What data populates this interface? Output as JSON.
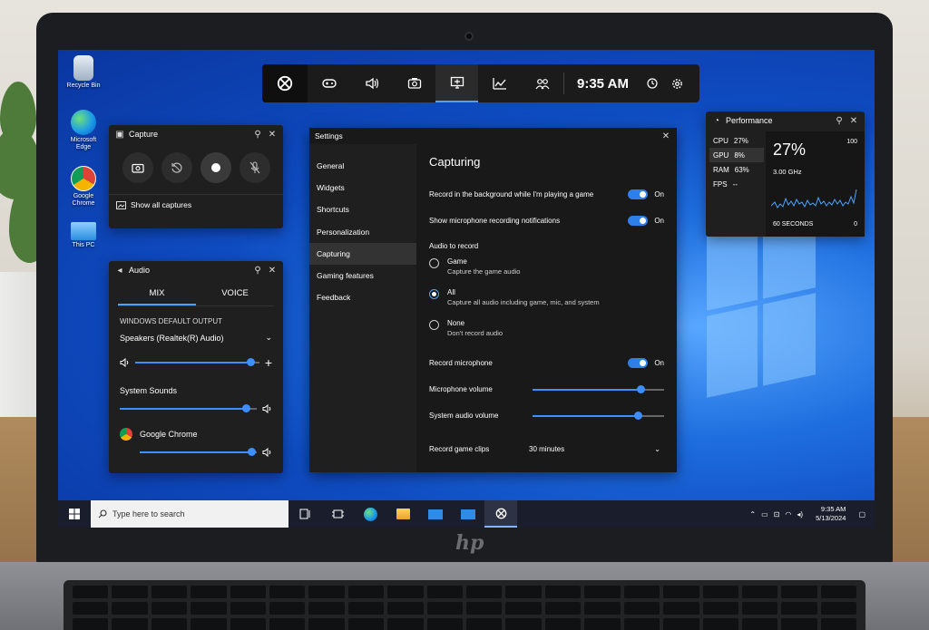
{
  "desktop": {
    "icons": [
      {
        "label": "Recycle Bin",
        "icon": "recycle-bin-icon"
      },
      {
        "label": "Microsoft Edge",
        "icon": "edge-icon"
      },
      {
        "label": "Google Chrome",
        "icon": "chrome-icon"
      },
      {
        "label": "This PC",
        "icon": "this-pc-icon"
      }
    ]
  },
  "gamebar": {
    "time": "9:35 AM",
    "buttons": [
      "xbox-icon",
      "controller-icon",
      "audio-icon",
      "capture-icon",
      "performance-monitor-icon",
      "chart-icon",
      "social-icon"
    ]
  },
  "capture": {
    "title": "Capture",
    "show_all": "Show all captures"
  },
  "audio": {
    "title": "Audio",
    "tabs": [
      "MIX",
      "VOICE"
    ],
    "output_label": "WINDOWS DEFAULT OUTPUT",
    "device": "Speakers (Realtek(R) Audio)",
    "master_volume": 0.93,
    "apps": [
      {
        "name": "System Sounds",
        "volume": 0.92
      },
      {
        "name": "Google Chrome",
        "volume": 0.95
      }
    ]
  },
  "settings": {
    "title": "Settings",
    "nav": [
      "General",
      "Widgets",
      "Shortcuts",
      "Personalization",
      "Capturing",
      "Gaming features",
      "Feedback"
    ],
    "selected_nav": "Capturing",
    "heading": "Capturing",
    "record_background": {
      "label": "Record in the background while I'm playing a game",
      "state": "On"
    },
    "mic_notifications": {
      "label": "Show microphone recording notifications",
      "state": "On"
    },
    "audio_to_record": "Audio to record",
    "radio": [
      {
        "title": "Game",
        "desc": "Capture the game audio",
        "selected": false
      },
      {
        "title": "All",
        "desc": "Capture all audio including game, mic, and system",
        "selected": true
      },
      {
        "title": "None",
        "desc": "Don't record audio",
        "selected": false
      }
    ],
    "record_mic": {
      "label": "Record microphone",
      "state": "On"
    },
    "mic_volume": {
      "label": "Microphone volume",
      "value": 0.82
    },
    "system_volume": {
      "label": "System audio volume",
      "value": 0.8
    },
    "record_clips": {
      "label": "Record game clips",
      "value": "30 minutes"
    }
  },
  "performance": {
    "title": "Performance",
    "metrics": [
      {
        "name": "CPU",
        "value": "27%"
      },
      {
        "name": "GPU",
        "value": "8%"
      },
      {
        "name": "RAM",
        "value": "63%"
      },
      {
        "name": "FPS",
        "value": "--"
      }
    ],
    "big_value": "27%",
    "max_label": "100",
    "freq": "3.00 GHz",
    "duration": "60 SECONDS",
    "min_label": "0"
  },
  "taskbar": {
    "search_placeholder": "Type here to search",
    "apps": [
      "task-view-icon",
      "widgets-icon",
      "edge-icon",
      "file-explorer-icon",
      "mail-icon",
      "mail-icon",
      "xbox-icon"
    ],
    "time": "9:35 AM",
    "date": "5/13/2024"
  },
  "colors": {
    "accent": "#3d8fff",
    "panel": "#1f1f1f",
    "taskbar": "#1a1e2c"
  }
}
